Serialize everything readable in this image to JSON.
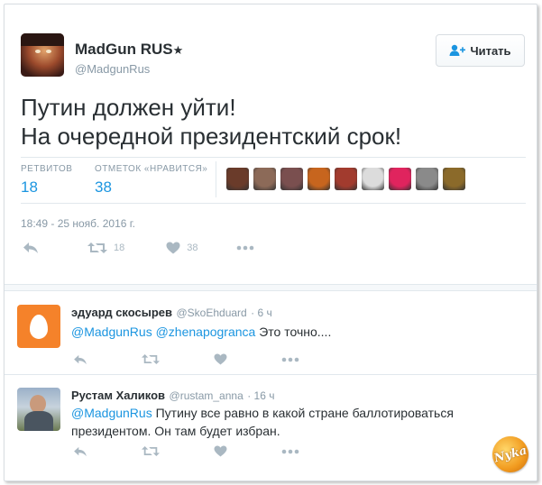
{
  "tweet": {
    "author_name": "MadGun RUS",
    "author_badge": "★",
    "author_handle": "@MadgunRus",
    "follow_label": "Читать",
    "text_line1": "Путин должен уйти!",
    "text_line2": "На очередной президентский срок!",
    "retweets_label": "РЕТВИТОВ",
    "retweets_count": "18",
    "likes_label": "ОТМЕТОК «НРАВИТСЯ»",
    "likes_count": "38",
    "timestamp": "18:49 - 25 нояб. 2016 г.",
    "action_retweet_count": "18",
    "action_like_count": "38"
  },
  "likers": [
    {
      "icon": "liker-avatar-1",
      "color": "#6a3b2a"
    },
    {
      "icon": "liker-avatar-2",
      "color": "#8c6a58"
    },
    {
      "icon": "liker-avatar-3",
      "color": "#7a4f4f"
    },
    {
      "icon": "liker-avatar-4",
      "color": "#c7651e"
    },
    {
      "icon": "liker-avatar-5",
      "color": "#a23b2e"
    },
    {
      "icon": "liker-avatar-6",
      "color": "#dcdcdc"
    },
    {
      "icon": "liker-avatar-7",
      "color": "#e0245e"
    },
    {
      "icon": "liker-avatar-8",
      "color": "#8a8a8a"
    },
    {
      "icon": "liker-avatar-9",
      "color": "#8b6a2a"
    }
  ],
  "replies": [
    {
      "name": "эдуард скосырев",
      "handle": "@SkoEhduard",
      "time": "· 6 ч",
      "mention1": "@MadgunRus",
      "mention2": "@zhenapogranca",
      "text": "Это точно....",
      "avatar_icon": "egg-icon",
      "avatar_color": "#f5822a"
    },
    {
      "name": "Рустам Халиков",
      "handle": "@rustam_anna",
      "time": "· 16 ч",
      "mention1": "@MadgunRus",
      "text": "Путину все равно в какой стране баллотироваться президентом. Он там будет избран.",
      "avatar_icon": "user-photo-icon"
    }
  ],
  "watermark": {
    "text": "Nyka"
  },
  "colors": {
    "accent": "#1b95e0",
    "muted": "#8899a6",
    "action": "#aab8c2"
  }
}
